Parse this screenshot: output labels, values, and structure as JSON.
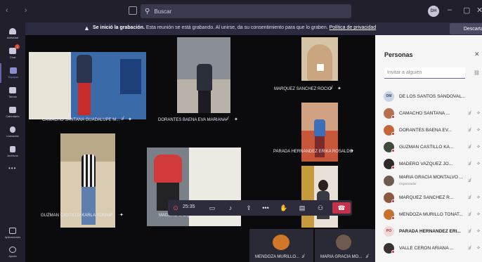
{
  "titlebar": {
    "search_placeholder": "Buscar",
    "user_initials": "DH",
    "window_controls": [
      "–",
      "▢",
      "✕"
    ]
  },
  "rail": {
    "items": [
      {
        "label": "Actividad",
        "icon": "bell-icon"
      },
      {
        "label": "Chat",
        "icon": "chat-icon",
        "badge": "1"
      },
      {
        "label": "Equipos",
        "icon": "teams-icon"
      },
      {
        "label": "Tareas",
        "icon": "assignments-icon"
      },
      {
        "label": "Calendario",
        "icon": "calendar-icon"
      },
      {
        "label": "Llamadas",
        "icon": "phone-icon"
      },
      {
        "label": "Archivos",
        "icon": "files-icon"
      }
    ],
    "more": "•••",
    "bottom_items": [
      {
        "label": "Aplicaciones",
        "icon": "apps-icon"
      },
      {
        "label": "Ayuda",
        "icon": "help-icon"
      }
    ]
  },
  "banner": {
    "title": "Se inició la grabación.",
    "message": "Esta reunión se está grabando. Al unirse, da su consentimiento para que lo graben.",
    "link": "Política de privacidad",
    "dismiss": "Descartar"
  },
  "videos": [
    {
      "name": "CAMACHO SANTANA GUADALUPE M..."
    },
    {
      "name": "DORANTES BAENA EVA MARIANA"
    },
    {
      "name": "MARQUEZ SANCHEZ ROCIO"
    },
    {
      "name": "PARADA HERNANDEZ ERIKA ROSALDO"
    },
    {
      "name": "GUZMAN CASTILLO KARLA YONNE"
    },
    {
      "name": "MADERO VAZQUEZ JONATHAN ALEX"
    }
  ],
  "controls": {
    "timer": "25:35"
  },
  "bottom_tiles": [
    {
      "name": "MENDOZA MURILLO..."
    },
    {
      "name": "MARIA GRACIA MO..."
    }
  ],
  "panel": {
    "title": "Personas",
    "invite_placeholder": "Invitar a alguien",
    "participants": [
      {
        "name": "DE LOS SANTOS SANDOVAL...",
        "initials": "DM",
        "avatar_color": "#c9d4e8"
      },
      {
        "name": "CAMACHO SANTANA ...",
        "initials": "",
        "avatar_color": "#b86f4e"
      },
      {
        "name": "DORANTES BAENA EV...",
        "initials": "",
        "avatar_color": "#c4653a"
      },
      {
        "name": "GUZMAN CASTILLO KA...",
        "initials": "",
        "avatar_color": "#3f4a3c"
      },
      {
        "name": "MADERO VAZQUEZ JO...",
        "initials": "",
        "avatar_color": "#2f2a28"
      },
      {
        "name": "MARIA GRACIA MONTALVO ...",
        "initials": "",
        "avatar_color": "#6e5a4e",
        "role": "Organizador"
      },
      {
        "name": "MARQUEZ SANCHEZ R...",
        "initials": "",
        "avatar_color": "#8a5a3e"
      },
      {
        "name": "MENDOZA MURILLO TONAT...",
        "initials": "",
        "avatar_color": "#c8702e"
      },
      {
        "name": "PARADA HERNANDEZ ERI...",
        "initials": "PO",
        "avatar_color": "#f3d6d6"
      },
      {
        "name": "VALLE CERON ARIANA ...",
        "initials": "",
        "avatar_color": "#3a3230"
      }
    ]
  }
}
